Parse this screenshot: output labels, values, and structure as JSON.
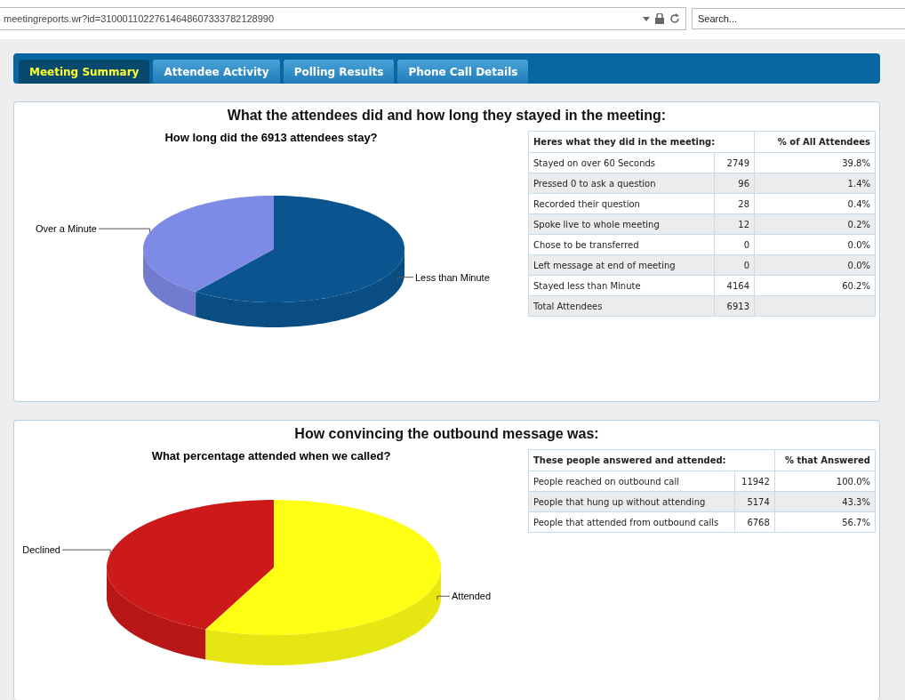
{
  "address_bar": {
    "url": "meetingreports.wr?id=31000110227614648607333782128990",
    "search": {
      "placeholder": "Search..."
    }
  },
  "tabs": [
    {
      "label": "Meeting Summary",
      "selected": true
    },
    {
      "label": "Attendee Activity",
      "selected": false
    },
    {
      "label": "Polling Results",
      "selected": false
    },
    {
      "label": "Phone Call Details",
      "selected": false
    }
  ],
  "panels": [
    {
      "title": "What the attendees did and how long they stayed in the meeting:",
      "pie": {
        "kind": "pie3d",
        "title": "How long did the 6913 attendees stay?",
        "slices": [
          {
            "label": "Less than Minute",
            "color": "#0a5590"
          },
          {
            "label": "Over a Minute",
            "color": "#7d8ae6"
          }
        ]
      },
      "table": {
        "columns": [
          {
            "label": "Heres what they did in the meeting:",
            "colspan": 2
          },
          {
            "label": "% of All Attendees"
          }
        ],
        "rows": [
          [
            "Stayed on over 60 Seconds",
            "2749",
            "39.8%"
          ],
          [
            "Pressed 0 to ask a question",
            "96",
            "1.4%"
          ],
          [
            "Recorded their question",
            "28",
            "0.4%"
          ],
          [
            "Spoke live to whole meeting",
            "12",
            "0.2%"
          ],
          [
            "Chose to be transferred",
            "0",
            "0.0%"
          ],
          [
            "Left message at end of meeting",
            "0",
            "0.0%"
          ],
          [
            "Stayed less than Minute",
            "4164",
            "60.2%"
          ],
          [
            "Total Attendees",
            "6913",
            ""
          ]
        ]
      }
    },
    {
      "title": "How convincing the outbound message was:",
      "pie": {
        "kind": "pie3d",
        "title": "What percentage attended when we called?",
        "slices": [
          {
            "label": "Attended",
            "color": "#ffff14"
          },
          {
            "label": "Declined",
            "color": "#cc1a1a"
          }
        ]
      },
      "table": {
        "columns": [
          {
            "label": "These people answered and attended:",
            "colspan": 2
          },
          {
            "label": "% that Answered"
          }
        ],
        "rows": [
          [
            "People reached on outbound call",
            "11942",
            "100.0%"
          ],
          [
            "People that hung up without attending",
            "5174",
            "43.3%"
          ],
          [
            "People that attended from outbound calls",
            "6768",
            "56.7%"
          ]
        ]
      }
    }
  ]
}
